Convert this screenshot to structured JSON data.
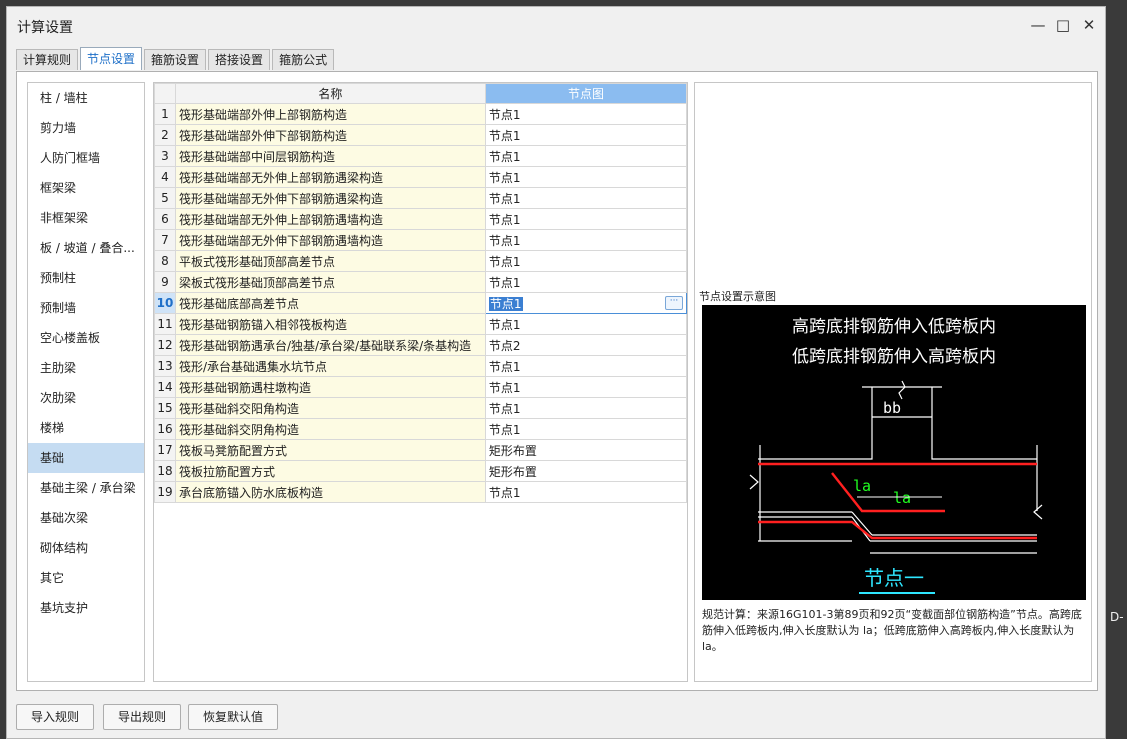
{
  "window": {
    "title": "计算设置"
  },
  "tabs": [
    {
      "label": "计算规则"
    },
    {
      "label": "节点设置"
    },
    {
      "label": "箍筋设置"
    },
    {
      "label": "搭接设置"
    },
    {
      "label": "箍筋公式"
    }
  ],
  "sidebar": {
    "items": [
      "柱 / 墙柱",
      "剪力墙",
      "人防门框墙",
      "框架梁",
      "非框架梁",
      "板 / 坡道 / 叠合...",
      "预制柱",
      "预制墙",
      "空心楼盖板",
      "主肋梁",
      "次肋梁",
      "楼梯",
      "基础",
      "基础主梁 / 承台梁",
      "基础次梁",
      "砌体结构",
      "其它",
      "基坑支护"
    ],
    "selected": "基础"
  },
  "grid": {
    "headers": {
      "name": "名称",
      "node": "节点图"
    },
    "rows": [
      {
        "idx": "1",
        "name": "筏形基础端部外伸上部钢筋构造",
        "value": "节点1"
      },
      {
        "idx": "2",
        "name": "筏形基础端部外伸下部钢筋构造",
        "value": "节点1"
      },
      {
        "idx": "3",
        "name": "筏形基础端部中间层钢筋构造",
        "value": "节点1"
      },
      {
        "idx": "4",
        "name": "筏形基础端部无外伸上部钢筋遇梁构造",
        "value": "节点1"
      },
      {
        "idx": "5",
        "name": "筏形基础端部无外伸下部钢筋遇梁构造",
        "value": "节点1"
      },
      {
        "idx": "6",
        "name": "筏形基础端部无外伸上部钢筋遇墙构造",
        "value": "节点1"
      },
      {
        "idx": "7",
        "name": "筏形基础端部无外伸下部钢筋遇墙构造",
        "value": "节点1"
      },
      {
        "idx": "8",
        "name": "平板式筏形基础顶部高差节点",
        "value": "节点1"
      },
      {
        "idx": "9",
        "name": "梁板式筏形基础顶部高差节点",
        "value": "节点1"
      },
      {
        "idx": "10",
        "name": "筏形基础底部高差节点",
        "value": "节点1"
      },
      {
        "idx": "11",
        "name": "筏形基础钢筋锚入相邻筏板构造",
        "value": "节点1"
      },
      {
        "idx": "12",
        "name": "筏形基础钢筋遇承台/独基/承台梁/基础联系梁/条基构造",
        "value": "节点2"
      },
      {
        "idx": "13",
        "name": "筏形/承台基础遇集水坑节点",
        "value": "节点1"
      },
      {
        "idx": "14",
        "name": "筏形基础钢筋遇柱墩构造",
        "value": "节点1"
      },
      {
        "idx": "15",
        "name": "筏形基础斜交阳角构造",
        "value": "节点1"
      },
      {
        "idx": "16",
        "name": "筏形基础斜交阴角构造",
        "value": "节点1"
      },
      {
        "idx": "17",
        "name": "筏板马凳筋配置方式",
        "value": "矩形布置"
      },
      {
        "idx": "18",
        "name": "筏板拉筋配置方式",
        "value": "矩形布置"
      },
      {
        "idx": "19",
        "name": "承台底筋锚入防水底板构造",
        "value": "节点1"
      }
    ],
    "selected_row": "10"
  },
  "preview": {
    "title": "节点设置示意图",
    "diagram": {
      "line1": "高跨底排钢筋伸入低跨板内",
      "line2": "低跨底排钢筋伸入高跨板内",
      "dim_bb": "bb",
      "label_la1": "la",
      "label_la2": "la",
      "caption": "节点一"
    },
    "note": "规范计算：来源16G101-3第89页和92页“变截面部位钢筋构造”节点。高跨底筋伸入低跨板内,伸入长度默认为 la；低跨底筋伸入高跨板内,伸入长度默认为 la。"
  },
  "footer": {
    "import": "导入规则",
    "export": "导出规则",
    "restore": "恢复默认值"
  },
  "background_text": "D-"
}
